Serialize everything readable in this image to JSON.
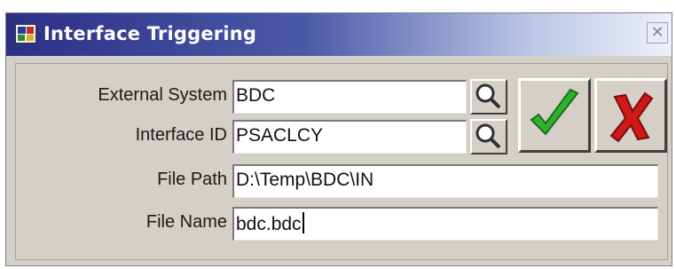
{
  "window": {
    "title": "Interface Triggering",
    "close_symbol": "✕"
  },
  "form": {
    "external_system": {
      "label": "External System",
      "value": "BDC"
    },
    "interface_id": {
      "label": "Interface ID",
      "value": "PSACLCY"
    },
    "file_path": {
      "label": "File Path",
      "value": "D:\\Temp\\BDC\\IN"
    },
    "file_name": {
      "label": "File Name",
      "value": "bdc.bdc"
    }
  },
  "icons": {
    "lov": "magnifier-icon",
    "ok": "checkmark-icon",
    "cancel": "red-x-icon",
    "app": "app-icon"
  },
  "colors": {
    "title_dark": "#2c2f86",
    "ok_green": "#2fb12f",
    "cancel_red": "#d01818"
  }
}
